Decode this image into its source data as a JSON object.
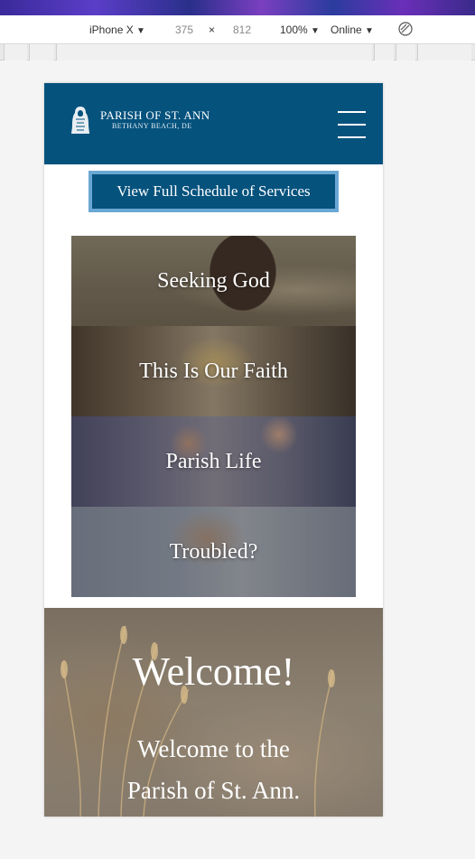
{
  "devtools": {
    "device": "iPhone X",
    "width": "375",
    "separator": "×",
    "height": "812",
    "zoom": "100%",
    "network": "Online",
    "dropdown_arrow": "▼"
  },
  "site": {
    "logo_title": "PARISH OF ST. ANN",
    "logo_subtitle": "BETHANY BEACH, DE",
    "schedule_button": "View Full Schedule of Services",
    "tiles": [
      {
        "label": "Seeking God"
      },
      {
        "label": "This Is Our Faith"
      },
      {
        "label": "Parish Life"
      },
      {
        "label": "Troubled?"
      }
    ],
    "welcome_title": "Welcome!",
    "welcome_line1": "Welcome to the",
    "welcome_line2": "Parish of St. Ann."
  },
  "colors": {
    "header_blue": "#05527d",
    "button_border": "#6aa7d3"
  },
  "icons": {
    "logo": "st-ann-statue-icon",
    "menu": "hamburger-menu-icon",
    "rotate": "rotate-device-icon"
  }
}
